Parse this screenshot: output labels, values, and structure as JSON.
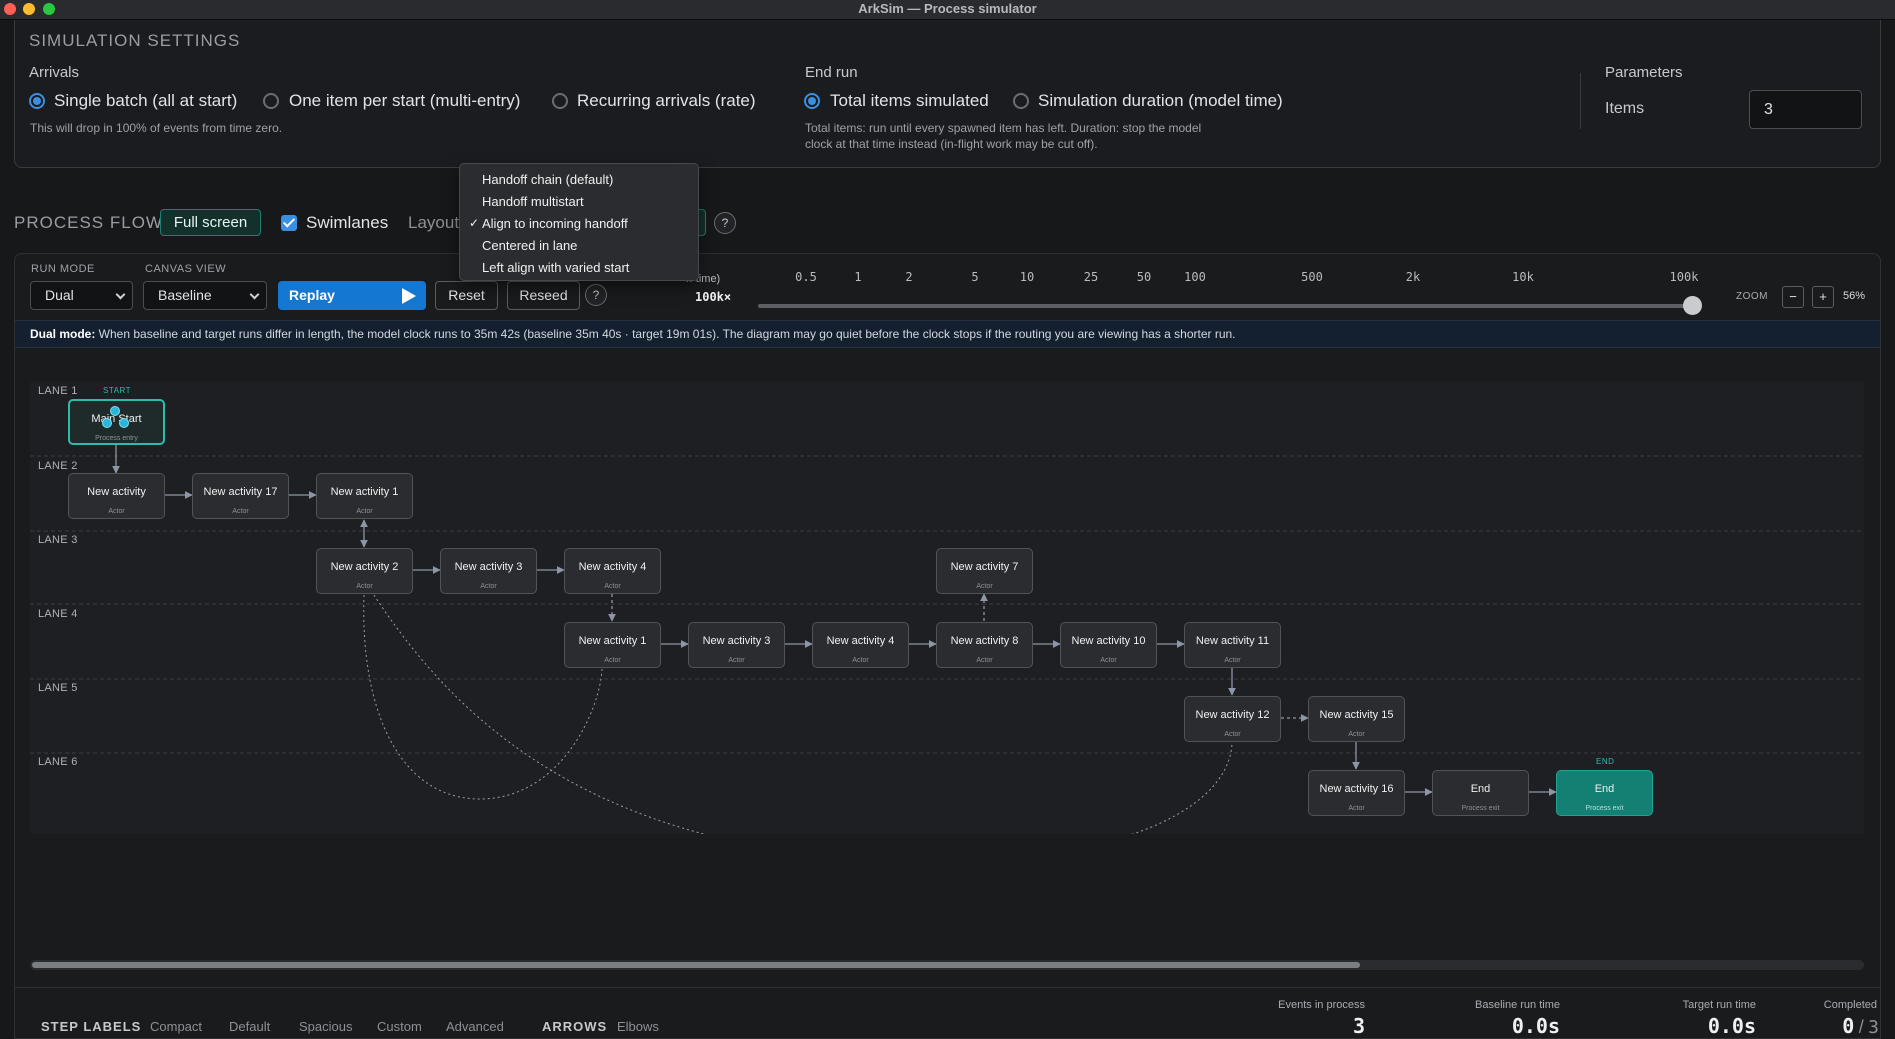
{
  "window": {
    "title": "ArkSim — Process simulator"
  },
  "settings": {
    "title": "SIMULATION SETTINGS",
    "arrivals": {
      "label": "Arrivals",
      "options": [
        "Single batch (all at start)",
        "One item per start (multi-entry)",
        "Recurring arrivals (rate)"
      ],
      "selected": "Single batch (all at start)",
      "hint": "This will drop in 100% of events from time zero."
    },
    "end_run": {
      "label": "End run",
      "options": [
        "Total items simulated",
        "Simulation duration (model time)"
      ],
      "selected": "Total items simulated",
      "hint_line1": "Total items: run until every spawned item has left. Duration: stop the model",
      "hint_line2": "clock at that time instead (in-flight work may be cut off)."
    },
    "parameters": {
      "label": "Parameters",
      "items_label": "Items",
      "items_value": "3"
    }
  },
  "flow_bar": {
    "title": "PROCESS FLOW",
    "fullscreen": "Full screen",
    "swimlanes": "Swimlanes",
    "swimlanes_checked": true,
    "layout_label": "Layout",
    "help": "?"
  },
  "layout_menu": {
    "items": [
      "Handoff chain (default)",
      "Handoff multistart",
      "Align to incoming handoff",
      "Centered in lane",
      "Left align with varied start"
    ],
    "checked": "Align to incoming handoff",
    "check_glyph": "✓"
  },
  "controls": {
    "run_mode_label": "RUN MODE",
    "run_mode": "Dual",
    "canvas_view_label": "CANVAS VIEW",
    "canvas_view": "Baseline",
    "replay": "Replay",
    "reset": "Reset",
    "reseed": "Reseed",
    "help": "?",
    "speed_label_partial": "n-time)",
    "speed_value": "100k×",
    "speed_ticks": [
      "0.5",
      "1",
      "2",
      "5",
      "10",
      "25",
      "50",
      "100",
      "500",
      "2k",
      "10k",
      "100k"
    ],
    "speed_fraction": 1.0,
    "zoom_label": "ZOOM",
    "zoom_minus": "−",
    "zoom_plus": "+",
    "zoom_value": "56%"
  },
  "banner": {
    "bold": "Dual mode:",
    "text": " When baseline and target runs differ in length, the model clock runs to 35m 42s (baseline 35m 40s · target 19m 01s). The diagram may go quiet before the clock stops if the routing you are viewing has a shorter run."
  },
  "lanes": [
    "LANE 1",
    "LANE 2",
    "LANE 3",
    "LANE 4",
    "LANE 5",
    "LANE 6"
  ],
  "nodes": {
    "start": {
      "tag": "START",
      "title": "Main Start",
      "sub": "Process entry"
    },
    "l2a": {
      "title": "New activity",
      "sub": "Actor"
    },
    "l2b": {
      "title": "New activity 17",
      "sub": "Actor"
    },
    "l2c": {
      "title": "New activity 1",
      "sub": "Actor"
    },
    "l3a": {
      "title": "New activity 2",
      "sub": "Actor"
    },
    "l3b": {
      "title": "New activity 3",
      "sub": "Actor"
    },
    "l3c": {
      "title": "New activity 4",
      "sub": "Actor"
    },
    "l3d": {
      "title": "New activity 7",
      "sub": "Actor"
    },
    "l4a": {
      "title": "New activity 1",
      "sub": "Actor"
    },
    "l4b": {
      "title": "New activity 3",
      "sub": "Actor"
    },
    "l4c": {
      "title": "New activity 4",
      "sub": "Actor"
    },
    "l4d": {
      "title": "New activity 8",
      "sub": "Actor"
    },
    "l4e": {
      "title": "New activity 10",
      "sub": "Actor"
    },
    "l4f": {
      "title": "New activity 11",
      "sub": "Actor"
    },
    "l5a": {
      "title": "New activity 12",
      "sub": "Actor"
    },
    "l5b": {
      "title": "New activity 15",
      "sub": "Actor"
    },
    "l6a": {
      "title": "New activity 16",
      "sub": "Actor"
    },
    "l6b": {
      "title": "End",
      "sub": "Process exit"
    },
    "l6c": {
      "tag": "END",
      "title": "End",
      "sub": "Process exit"
    }
  },
  "footer": {
    "step_labels": "STEP LABELS",
    "step_options": [
      "Compact",
      "Default",
      "Spacious",
      "Custom",
      "Advanced"
    ],
    "arrows": "ARROWS",
    "arrow_options": [
      "Elbows"
    ],
    "stats": {
      "events_label": "Events in process",
      "events_value": "3",
      "baseline_label": "Baseline run time",
      "baseline_value": "0.0s",
      "target_label": "Target run time",
      "target_value": "0.0s",
      "completed_label": "Completed",
      "completed_value": "0",
      "completed_sep": "/",
      "completed_total": "3"
    }
  },
  "colors": {
    "accent_blue": "#1478d2",
    "accent_teal": "#147f73",
    "banner_bg": "#142030"
  }
}
